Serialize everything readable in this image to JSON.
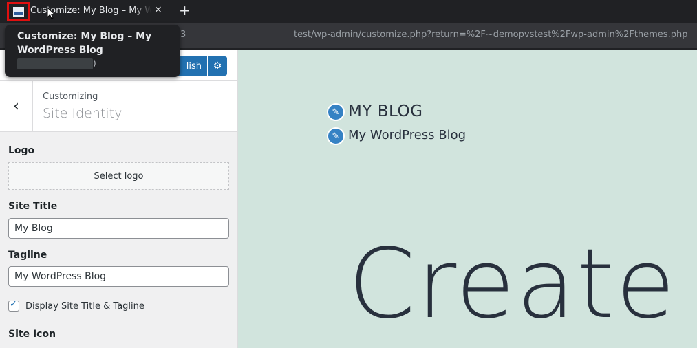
{
  "browser": {
    "tab_title": "Customize: My Blog – My WordPress Blog",
    "tab_close": "×",
    "new_tab": "+",
    "url_partial": "3",
    "url": "test/wp-admin/customize.php?return=%2F~demopvstest%2Fwp-admin%2Fthemes.php",
    "tooltip": {
      "title": "Customize: My Blog – My WordPress Blog",
      "url_tail": ")"
    }
  },
  "customizer": {
    "publish_label": "Publish",
    "publish_visible": "lish",
    "gear_icon": "⚙",
    "back_icon": "‹",
    "customizing_label": "Customizing",
    "section_title": "Site Identity",
    "logo_label": "Logo",
    "select_logo_label": "Select logo",
    "site_title_label": "Site Title",
    "site_title_value": "My Blog",
    "tagline_label": "Tagline",
    "tagline_value": "My WordPress Blog",
    "display_title_tagline_label": "Display Site Title & Tagline",
    "display_title_tagline_checked": true,
    "site_icon_label": "Site Icon"
  },
  "preview": {
    "site_title": "MY BLOG",
    "site_description": "My WordPress Blog",
    "hero_text": "Create y",
    "edit_icon": "✎",
    "background_color": "#d1e4dd"
  },
  "colors": {
    "accent": "#2271b1",
    "highlight_outline": "#e01010"
  }
}
